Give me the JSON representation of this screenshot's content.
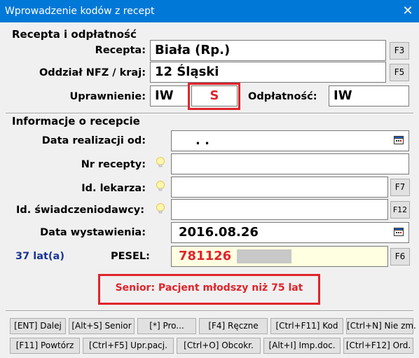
{
  "window": {
    "title": "Wprowadzenie kodów z recept",
    "close_glyph": "✕"
  },
  "section1": {
    "title": "Recepta i odpłatność"
  },
  "recepta": {
    "label": "Recepta:",
    "value": "Biała (Rp.)",
    "button": "F3"
  },
  "oddzial": {
    "label": "Oddział NFZ / kraj:",
    "value": "12 Śląski",
    "button": "F5"
  },
  "uprawnienie": {
    "label": "Uprawnienie:",
    "value": "IW",
    "value2": "S"
  },
  "odplatnosc": {
    "label": "Odpłatność:",
    "value": "IW"
  },
  "section2": {
    "title": "Informacje o recepcie"
  },
  "data_realizacji": {
    "label": "Data realizacji od:",
    "value": ". ."
  },
  "nr_recepty": {
    "label": "Nr recepty:",
    "value": ""
  },
  "id_lekarza": {
    "label": "Id. lekarza:",
    "value": "",
    "button": "F7"
  },
  "id_swiadczeniodawcy": {
    "label": "Id. świadczeniodawcy:",
    "value": "",
    "button": "F12"
  },
  "data_wystawienia": {
    "label": "Data wystawienia:",
    "value": "2016.08.26"
  },
  "age": {
    "text": "37 lat(a)"
  },
  "pesel": {
    "label": "PESEL:",
    "value": "781126",
    "button": "F6"
  },
  "senior_message": "Senior: Pacjent młodszy niż 75 lat",
  "bottom_row1": [
    "[ENT] Dalej",
    "[Alt+S] Senior",
    "[*] Pro...",
    "[F4] Ręczne",
    "[Ctrl+F11] Kod",
    "[Ctrl+N] Nie zm."
  ],
  "bottom_row2": [
    "[F11] Powtórz",
    "[Ctrl+F5] Upr.pacj.",
    "[Ctrl+O] Obcokr.",
    "[Alt+I] Imp.doc.",
    "[Ctrl+F12] Ord."
  ],
  "colors": {
    "titlebar": "#0078d7",
    "red": "#e0242b",
    "pesel_bg": "#ffffe1",
    "age_text": "#1a3399"
  }
}
